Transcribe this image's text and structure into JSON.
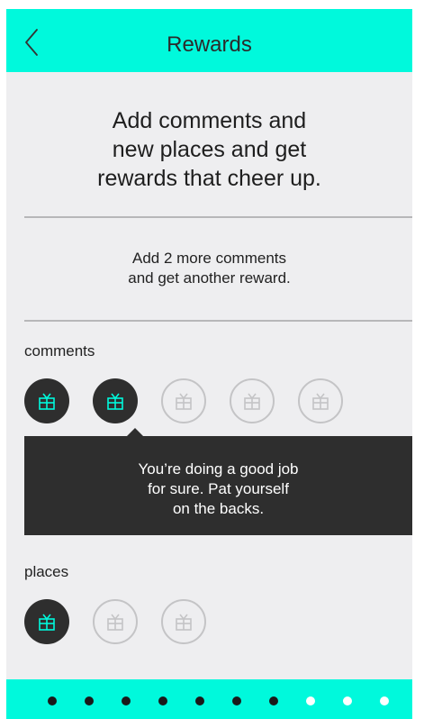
{
  "header": {
    "title": "Rewards",
    "back_icon": "chevron-left-icon"
  },
  "intro": {
    "line1": "Add comments and",
    "line2": "new places and get",
    "line3": "rewards that cheer up."
  },
  "progress": {
    "line1": "Add 2 more comments",
    "line2": "and get another reward."
  },
  "comments": {
    "label": "comments",
    "gifts": [
      {
        "earned": true,
        "icon": "gift-icon"
      },
      {
        "earned": true,
        "icon": "gift-icon"
      },
      {
        "earned": false,
        "icon": "gift-icon"
      },
      {
        "earned": false,
        "icon": "gift-icon"
      },
      {
        "earned": false,
        "icon": "gift-icon"
      }
    ]
  },
  "tooltip": {
    "line1": "You’re doing a good job",
    "line2": "for sure. Pat yourself",
    "line3": "on the backs."
  },
  "places": {
    "label": "places",
    "gifts": [
      {
        "earned": true,
        "icon": "gift-icon"
      },
      {
        "earned": false,
        "icon": "gift-icon"
      },
      {
        "earned": false,
        "icon": "gift-icon"
      }
    ]
  },
  "pager": {
    "total": 10,
    "current": 7
  },
  "colors": {
    "accent": "#00f9dc",
    "dark": "#2e2e2e",
    "inactive": "#c4c4c6",
    "background": "#eeeef0"
  }
}
